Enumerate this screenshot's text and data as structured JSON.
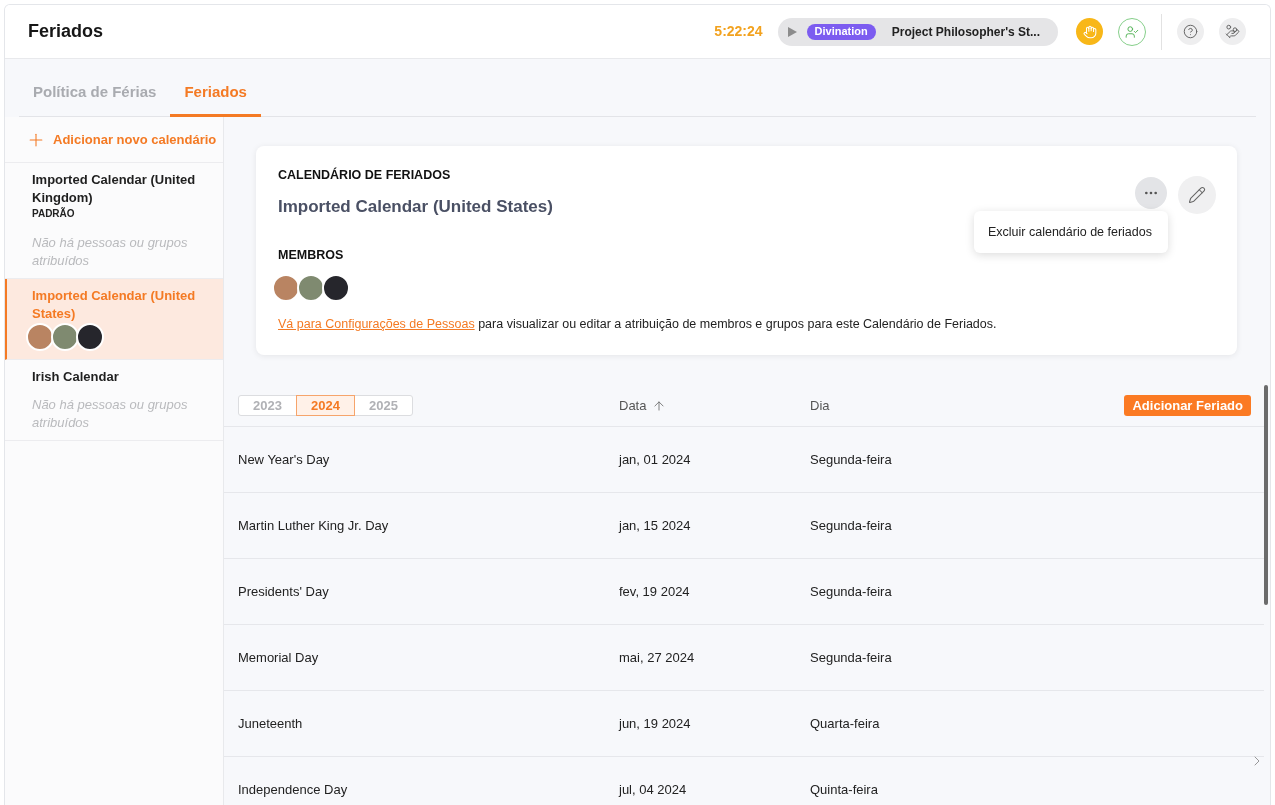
{
  "header": {
    "title": "Feriados",
    "timer": "5:22:24",
    "tracker": {
      "tag": "Divination",
      "project": "Project Philosopher's St..."
    }
  },
  "tabs": [
    {
      "label": "Política de Férias",
      "selected": false
    },
    {
      "label": "Feriados",
      "selected": true
    }
  ],
  "sidebar": {
    "add_label": "Adicionar novo calendário",
    "items": [
      {
        "name": "Imported Calendar (United Kingdom)",
        "badge": "PADRÃO",
        "note": "Não há pessoas ou grupos atribuídos",
        "selected": false
      },
      {
        "name": "Imported Calendar (United States)",
        "members": [
          {
            "kind": "photo"
          },
          {
            "kind": "photo"
          },
          {
            "kind": "photo"
          }
        ],
        "selected": true
      },
      {
        "name": "Irish Calendar",
        "note": "Não há pessoas ou grupos atribuídos",
        "selected": false
      }
    ]
  },
  "card": {
    "heading": "CALENDÁRIO DE FERIADOS",
    "name": "Imported Calendar (United States)",
    "members_heading": "MEMBROS",
    "members": [
      {
        "kind": "photo"
      },
      {
        "kind": "photo"
      },
      {
        "kind": "photo"
      }
    ],
    "link": "Vá para Configurações de Pessoas",
    "hint": "para visualizar ou editar a atribuição de membros e grupos para este Calendário de Feriados.",
    "menu": {
      "open": true,
      "items": [
        "Excluir calendário de feriados"
      ]
    }
  },
  "table": {
    "years": [
      {
        "label": "2023",
        "selected": false
      },
      {
        "label": "2024",
        "selected": true
      },
      {
        "label": "2025",
        "selected": false
      }
    ],
    "columns": [
      {
        "label": "Data",
        "sorted": true
      },
      {
        "label": "Dia",
        "sorted": false
      }
    ],
    "add_button": "Adicionar Feriado",
    "rows": [
      {
        "name": "New Year's Day",
        "date": "jan, 01 2024",
        "day": "Segunda-feira"
      },
      {
        "name": "Martin Luther King Jr. Day",
        "date": "jan, 15 2024",
        "day": "Segunda-feira"
      },
      {
        "name": "Presidents' Day",
        "date": "fev, 19 2024",
        "day": "Segunda-feira"
      },
      {
        "name": "Memorial Day",
        "date": "mai, 27 2024",
        "day": "Segunda-feira"
      },
      {
        "name": "Juneteenth",
        "date": "jun, 19 2024",
        "day": "Quarta-feira"
      },
      {
        "name": "Independence Day",
        "date": "jul, 04 2024",
        "day": "Quinta-feira"
      }
    ]
  }
}
